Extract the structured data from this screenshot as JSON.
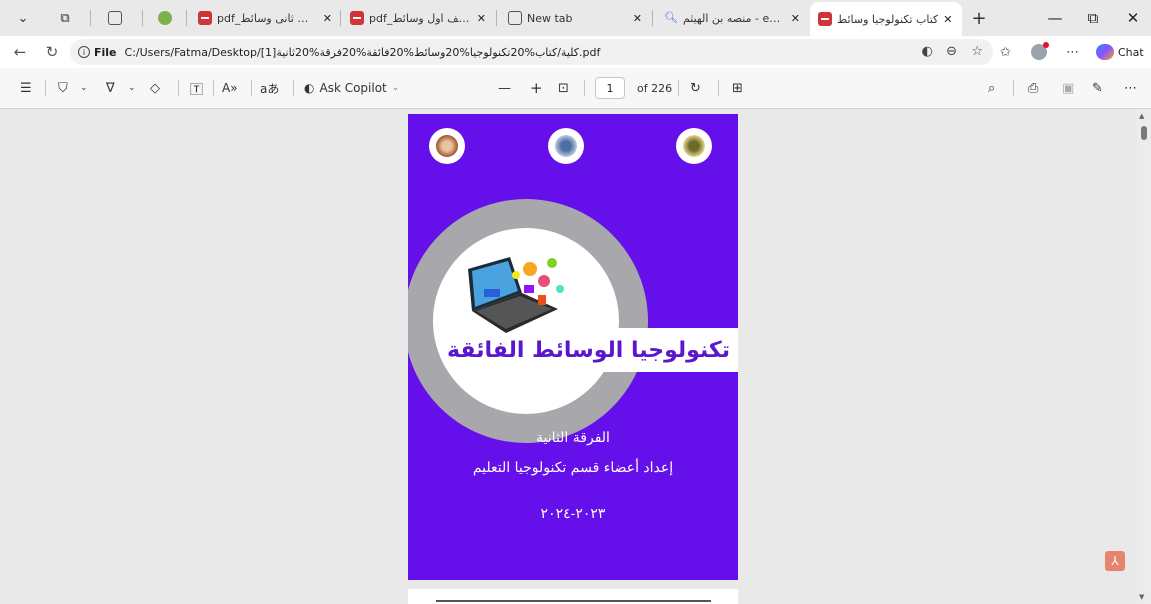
{
  "tabs": [
    {
      "title": "pdf_تكليف ثانى وسائط",
      "icon": "pdf-icon"
    },
    {
      "title": "pdf_تكليف اول وسائط",
      "icon": "pdf-icon"
    },
    {
      "title": "New tab",
      "icon": "newtab-icon"
    },
    {
      "title": "منصه بن الهيثم - earch",
      "icon": "search-icon"
    },
    {
      "title": "كتاب تكنولوجيا وسائط",
      "icon": "pdf-icon",
      "active": true
    }
  ],
  "tab_close": "✕",
  "new_tab_label": "+",
  "address": {
    "scheme": "File",
    "url": "C:/Users/Fatma/Desktop/[1]كلية/كتاب%20تكنولوجيا%20وسائط%20فائقة%20فرقة%20ثانية.pdf"
  },
  "chat_label": "Chat",
  "toolbar": {
    "ask_copilot": "Ask Copilot",
    "page_current": "1",
    "page_total": "of 226"
  },
  "document": {
    "title": "تكنولوجيا الوسائط الفائقة",
    "grade": "الفرقة الثانية",
    "prepared_by": "إعداد أعضاء قسم تكنولوجيا التعليم",
    "year": "٢٠٢٣-٢٠٢٤"
  },
  "colors": {
    "page_bg": "#6510ea",
    "title_color": "#5b16d0",
    "ring_gray": "#a8a8ac"
  }
}
